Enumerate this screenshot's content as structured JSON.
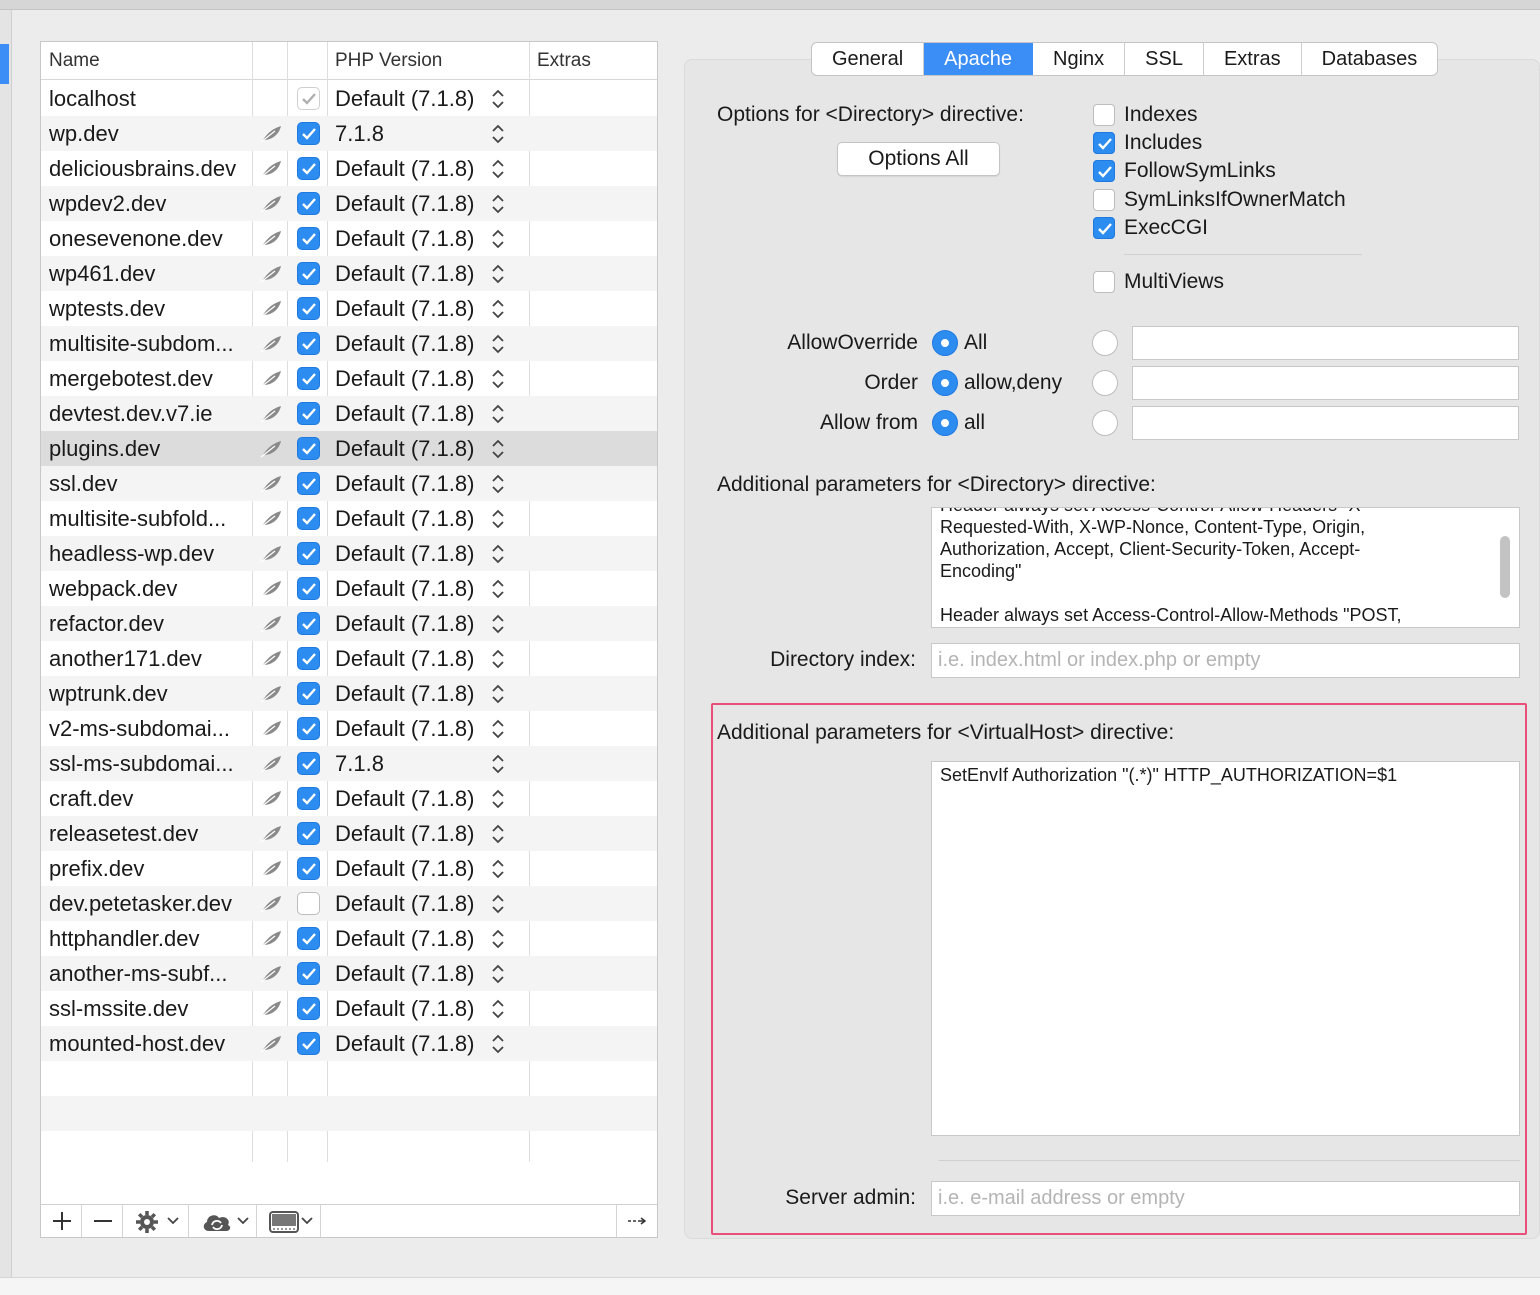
{
  "table": {
    "columns": [
      "Name",
      "",
      "",
      "PHP Version",
      "Extras"
    ],
    "rows": [
      {
        "name": "localhost",
        "enabled": "dim",
        "php": "Default (7.1.8)",
        "leaf": false,
        "selected": false
      },
      {
        "name": "wp.dev",
        "enabled": "on",
        "php": "7.1.8",
        "leaf": true,
        "selected": false
      },
      {
        "name": "deliciousbrains.dev",
        "enabled": "on",
        "php": "Default (7.1.8)",
        "leaf": true,
        "selected": false
      },
      {
        "name": "wpdev2.dev",
        "enabled": "on",
        "php": "Default (7.1.8)",
        "leaf": true,
        "selected": false
      },
      {
        "name": "onesevenone.dev",
        "enabled": "on",
        "php": "Default (7.1.8)",
        "leaf": true,
        "selected": false
      },
      {
        "name": "wp461.dev",
        "enabled": "on",
        "php": "Default (7.1.8)",
        "leaf": true,
        "selected": false
      },
      {
        "name": "wptests.dev",
        "enabled": "on",
        "php": "Default (7.1.8)",
        "leaf": true,
        "selected": false
      },
      {
        "name": "multisite-subdom...",
        "enabled": "on",
        "php": "Default (7.1.8)",
        "leaf": true,
        "selected": false
      },
      {
        "name": "mergebotest.dev",
        "enabled": "on",
        "php": "Default (7.1.8)",
        "leaf": true,
        "selected": false
      },
      {
        "name": "devtest.dev.v7.ie",
        "enabled": "on",
        "php": "Default (7.1.8)",
        "leaf": true,
        "selected": false
      },
      {
        "name": "plugins.dev",
        "enabled": "on",
        "php": "Default (7.1.8)",
        "leaf": true,
        "selected": true
      },
      {
        "name": "ssl.dev",
        "enabled": "on",
        "php": "Default (7.1.8)",
        "leaf": true,
        "selected": false
      },
      {
        "name": "multisite-subfold...",
        "enabled": "on",
        "php": "Default (7.1.8)",
        "leaf": true,
        "selected": false
      },
      {
        "name": "headless-wp.dev",
        "enabled": "on",
        "php": "Default (7.1.8)",
        "leaf": true,
        "selected": false
      },
      {
        "name": "webpack.dev",
        "enabled": "on",
        "php": "Default (7.1.8)",
        "leaf": true,
        "selected": false
      },
      {
        "name": "refactor.dev",
        "enabled": "on",
        "php": "Default (7.1.8)",
        "leaf": true,
        "selected": false
      },
      {
        "name": "another171.dev",
        "enabled": "on",
        "php": "Default (7.1.8)",
        "leaf": true,
        "selected": false
      },
      {
        "name": "wptrunk.dev",
        "enabled": "on",
        "php": "Default (7.1.8)",
        "leaf": true,
        "selected": false
      },
      {
        "name": "v2-ms-subdomai...",
        "enabled": "on",
        "php": "Default (7.1.8)",
        "leaf": true,
        "selected": false
      },
      {
        "name": "ssl-ms-subdomai...",
        "enabled": "on",
        "php": "7.1.8",
        "leaf": true,
        "selected": false
      },
      {
        "name": "craft.dev",
        "enabled": "on",
        "php": "Default (7.1.8)",
        "leaf": true,
        "selected": false
      },
      {
        "name": "releasetest.dev",
        "enabled": "on",
        "php": "Default (7.1.8)",
        "leaf": true,
        "selected": false
      },
      {
        "name": "prefix.dev",
        "enabled": "on",
        "php": "Default (7.1.8)",
        "leaf": true,
        "selected": false
      },
      {
        "name": "dev.petetasker.dev",
        "enabled": "off",
        "php": "Default (7.1.8)",
        "leaf": true,
        "selected": false
      },
      {
        "name": "httphandler.dev",
        "enabled": "on",
        "php": "Default (7.1.8)",
        "leaf": true,
        "selected": false
      },
      {
        "name": "another-ms-subf...",
        "enabled": "on",
        "php": "Default (7.1.8)",
        "leaf": true,
        "selected": false
      },
      {
        "name": "ssl-mssite.dev",
        "enabled": "on",
        "php": "Default (7.1.8)",
        "leaf": true,
        "selected": false
      },
      {
        "name": "mounted-host.dev",
        "enabled": "on",
        "php": "Default (7.1.8)",
        "leaf": true,
        "selected": false
      }
    ],
    "horizontal_scroll_position": 0
  },
  "toolbar": {
    "icons": [
      "plus-icon",
      "minus-icon",
      "gear-icon",
      "chevron-down-icon",
      "cloud-sync-icon",
      "chevron-down-icon",
      "display-icon",
      "chevron-down-icon",
      "more-arrow-icon"
    ]
  },
  "tabs": [
    "General",
    "Apache",
    "Nginx",
    "SSL",
    "Extras",
    "Databases"
  ],
  "active_tab": "Apache",
  "apache": {
    "directory_options_label": "Options for <Directory> directive:",
    "options_all_button": "Options All",
    "options": [
      {
        "label": "Indexes",
        "checked": false
      },
      {
        "label": "Includes",
        "checked": true
      },
      {
        "label": "FollowSymLinks",
        "checked": true
      },
      {
        "label": "SymLinksIfOwnerMatch",
        "checked": false
      },
      {
        "label": "ExecCGI",
        "checked": true
      }
    ],
    "multiviews": {
      "label": "MultiViews",
      "checked": false
    },
    "allow_override": {
      "label": "AllowOverride",
      "value": "All"
    },
    "order": {
      "label": "Order",
      "value": "allow,deny"
    },
    "allow_from": {
      "label": "Allow from",
      "value": "all"
    },
    "additional_directory_label": "Additional parameters for <Directory> directive:",
    "additional_directory_lines": [
      "Header always set Access-Control-Allow-Headers \"X-",
      "Requested-With, X-WP-Nonce, Content-Type, Origin,",
      "Authorization, Accept, Client-Security-Token, Accept-",
      "Encoding\"",
      "",
      "Header always set Access-Control-Allow-Methods \"POST,"
    ],
    "directory_index": {
      "label": "Directory index:",
      "placeholder": "i.e. index.html or index.php or empty",
      "value": ""
    },
    "virtualhost_label": "Additional parameters for <VirtualHost> directive:",
    "virtualhost_value": "SetEnvIf Authorization \"(.*)\" HTTP_AUTHORIZATION=$1",
    "server_admin": {
      "label": "Server admin:",
      "placeholder": "i.e. e-mail address or empty",
      "value": ""
    }
  },
  "colors": {
    "accent": "#2d8cf0",
    "highlight_box": "#e8507a"
  }
}
